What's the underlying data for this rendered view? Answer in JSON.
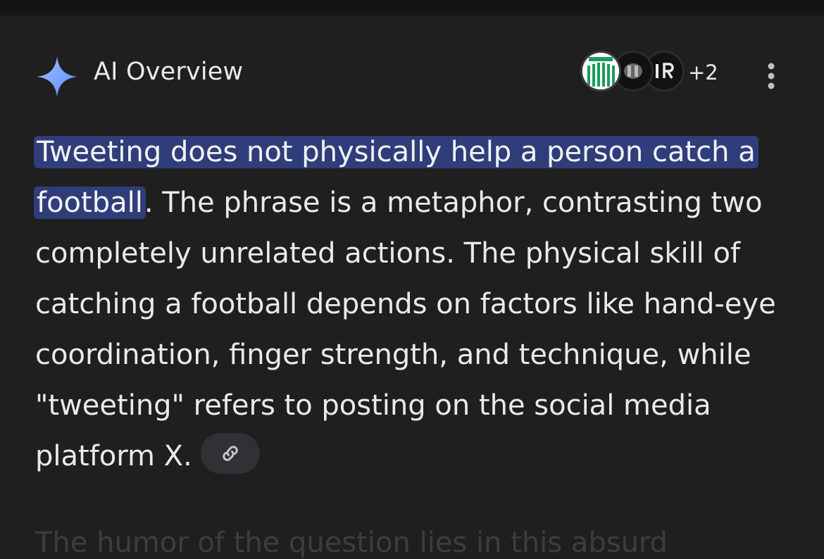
{
  "header": {
    "title": "AI Overview",
    "source_more_count": "+2",
    "sparkle_icon": "sparkle-icon",
    "menu_icon": "more-vert-icon"
  },
  "answer": {
    "highlighted": "Tweeting does not physically help a person catch a football",
    "body": ". The phrase is a metaphor, contrasting two completely unrelated actions. The physical skill of catching a football depends on factors like hand-eye coordination, finger strength, and technique, while \"tweeting\" refers to posting on the social media platform X.",
    "link_icon": "link-icon"
  },
  "faded_next": "The humor of the question lies in this absurd",
  "colors": {
    "background": "#1f1f1f",
    "text": "#e8eaed",
    "highlight": "#2f3d7a",
    "sparkle": "#7aa7ff",
    "chip": "#303134"
  }
}
